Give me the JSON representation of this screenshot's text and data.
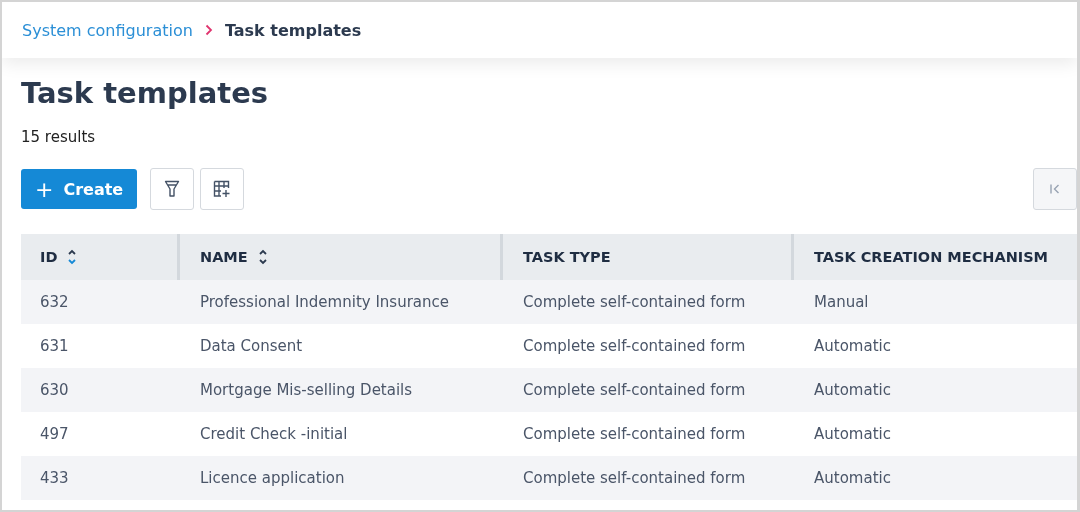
{
  "breadcrumb": [
    {
      "label": "System configuration",
      "kind": "link"
    },
    {
      "label": "Task templates",
      "kind": "current"
    }
  ],
  "title": "Task templates",
  "result_count": "15 results",
  "toolbar": {
    "create_button": {
      "icon": "+",
      "label": "Create"
    }
  },
  "pagination": {
    "first_page_disabled": true
  },
  "table": {
    "columns": [
      {
        "label": "ID",
        "sortable": true,
        "sorted_descending": true
      },
      {
        "label": "NAME",
        "sortable": true,
        "sorted_descending": false
      },
      {
        "label": "TASK TYPE"
      },
      {
        "label": "TASK CREATION MECHANISM"
      }
    ],
    "rows": [
      [
        "632",
        "Professional Indemnity Insurance",
        "Complete self-contained form",
        "Manual"
      ],
      [
        "631",
        "Data Consent",
        "Complete self-contained form",
        "Automatic"
      ],
      [
        "630",
        "Mortgage Mis-selling Details",
        "Complete self-contained form",
        "Automatic"
      ],
      [
        "497",
        "Credit Check -initial",
        "Complete self-contained form",
        "Automatic"
      ],
      [
        "433",
        "Licence application",
        "Complete self-contained form",
        "Automatic"
      ]
    ]
  }
}
